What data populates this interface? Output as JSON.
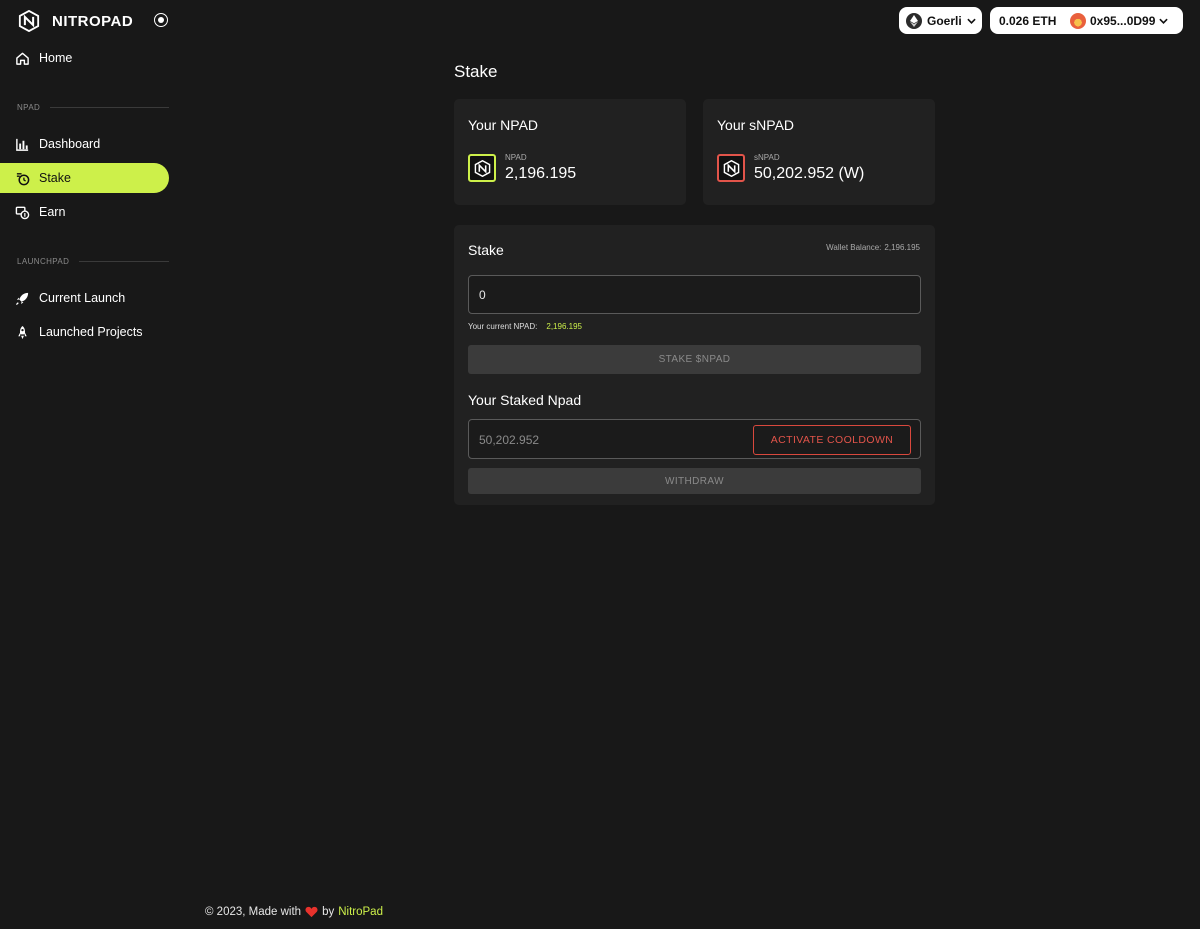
{
  "brand": {
    "name": "NITROPAD"
  },
  "sidebar": {
    "home": "Home",
    "section_npad": "NPAD",
    "dashboard": "Dashboard",
    "stake": "Stake",
    "earn": "Earn",
    "section_launchpad": "LAUNCHPAD",
    "current_launch": "Current Launch",
    "launched_projects": "Launched Projects"
  },
  "topbar": {
    "network": "Goerli",
    "balance": "0.026 ETH",
    "address": "0x95...0D99"
  },
  "page": {
    "title": "Stake"
  },
  "npad_card": {
    "title": "Your NPAD",
    "label": "NPAD",
    "value": "2,196.195"
  },
  "snpad_card": {
    "title": "Your sNPAD",
    "label": "sNPAD",
    "value": "50,202.952 (W)"
  },
  "stake": {
    "title": "Stake",
    "wallet_balance_label": "Wallet Balance:",
    "wallet_balance_value": "2,196.195",
    "input_value": "0",
    "current_npad_label": "Your current NPAD:",
    "current_npad_value": "2,196.195",
    "stake_button": "STAKE $NPAD",
    "staked_title": "Your Staked Npad",
    "staked_value": "50,202.952",
    "cooldown_button": "ACTIVATE COOLDOWN",
    "withdraw_button": "WITHDRAW"
  },
  "footer": {
    "text": "© 2023, Made with",
    "by": "by",
    "link": "NitroPad"
  },
  "colors": {
    "accent": "#cdf04a",
    "danger": "#e2544a",
    "background": "#181818",
    "card": "#212121"
  }
}
